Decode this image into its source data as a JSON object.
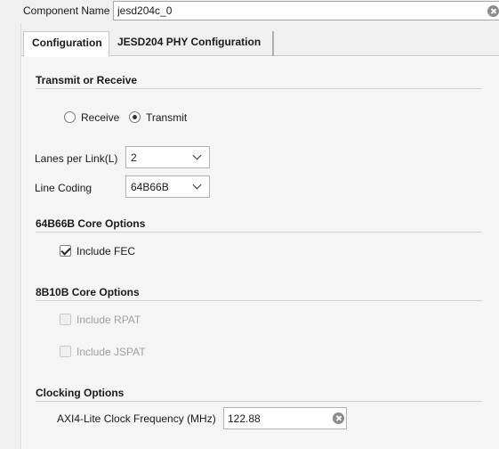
{
  "component": {
    "label": "Component Name",
    "value": "jesd204c_0"
  },
  "tabs": [
    {
      "label": "Configuration",
      "active": true
    },
    {
      "label": "JESD204 PHY Configuration",
      "active": false
    }
  ],
  "transmit_or_receive": {
    "title": "Transmit or Receive",
    "options": [
      {
        "label": "Receive",
        "selected": false
      },
      {
        "label": "Transmit",
        "selected": true
      }
    ]
  },
  "lanes_per_link": {
    "label": "Lanes per Link(L)",
    "value": "2"
  },
  "line_coding": {
    "label": "Line Coding",
    "value": "64B66B"
  },
  "core_64b66b": {
    "title": "64B66B Core Options",
    "include_fec": {
      "label": "Include FEC",
      "checked": true
    }
  },
  "core_8b10b": {
    "title": "8B10B Core Options",
    "include_rpat": {
      "label": "Include RPAT",
      "checked": false,
      "enabled": false
    },
    "include_jspat": {
      "label": "Include JSPAT",
      "checked": false,
      "enabled": false
    }
  },
  "clocking": {
    "title": "Clocking Options",
    "axi_freq_label": "AXI4-Lite Clock Frequency (MHz)",
    "axi_freq_value": "122.88"
  },
  "colors": {
    "panel_bg": "#f5f5f5",
    "header_bg": "#f0f0f0",
    "disabled_text": "#a0a0a0"
  }
}
